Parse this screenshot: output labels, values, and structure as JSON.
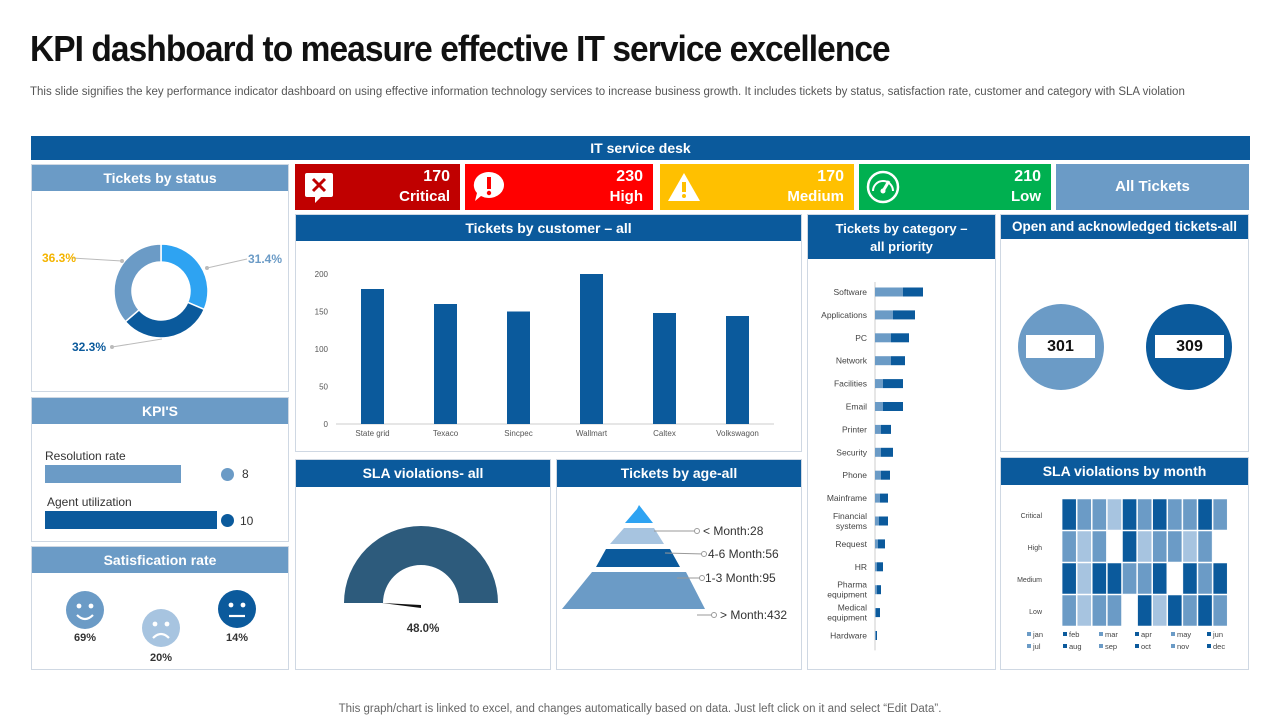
{
  "header": {
    "title": "KPI dashboard to measure effective IT service excellence",
    "subtitle": "This slide signifies the key performance indicator dashboard on using effective information technology services to increase business growth. It includes tickets by status, satisfaction rate, customer and category with SLA violation"
  },
  "banner": "IT service desk",
  "colors": {
    "dark_blue": "#0b5a9c",
    "mid_blue": "#6b9bc6",
    "light_blue": "#a7c4e0",
    "critical": "#c00000",
    "high": "#ff0000",
    "medium": "#ffc000",
    "low": "#00b050"
  },
  "status_cards": [
    {
      "value": "170",
      "label": "Critical",
      "icon": "x-alert-icon"
    },
    {
      "value": "230",
      "label": "High",
      "icon": "exclamation-bubble-icon"
    },
    {
      "value": "170",
      "label": "Medium",
      "icon": "warning-triangle-icon"
    },
    {
      "value": "210",
      "label": "Low",
      "icon": "speedometer-icon"
    }
  ],
  "all_tickets": "All Tickets",
  "tickets_by_status": {
    "title": "Tickets by status",
    "labels": [
      "36.3%",
      "31.4%",
      "32.3%"
    ],
    "chart_data": {
      "type": "pie",
      "values": [
        36.3,
        31.4,
        32.3
      ]
    }
  },
  "kpis": {
    "title": "KPI'S",
    "items": [
      {
        "label": "Resolution rate",
        "value": "8"
      },
      {
        "label": "Agent utilization",
        "value": "10"
      }
    ]
  },
  "satisfaction": {
    "title": "Satisfication rate",
    "items": [
      {
        "label": "69%",
        "icon": "happy-face-icon"
      },
      {
        "label": "20%",
        "icon": "sad-face-icon"
      },
      {
        "label": "14%",
        "icon": "neutral-face-icon"
      }
    ]
  },
  "tickets_by_customer": {
    "title": "Tickets by customer – all",
    "chart_data": {
      "type": "bar",
      "categories": [
        "State grid",
        "Texaco",
        "Sincpec",
        "Wallmart",
        "Caltex",
        "Volkswagon"
      ],
      "values": [
        180,
        160,
        150,
        200,
        148,
        144
      ],
      "ylim": [
        0,
        200
      ],
      "yticks": [
        "0",
        "50",
        "100",
        "150",
        "200"
      ]
    }
  },
  "tickets_by_category": {
    "title_line1": "Tickets by category –",
    "title_line2": "all priority",
    "chart_data": {
      "type": "bar",
      "categories": [
        "Software",
        "Applications",
        "PC",
        "Network",
        "Facilities",
        "Email",
        "Printer",
        "Security",
        "Phone",
        "Mainframe",
        "Financial systems",
        "Request",
        "HR",
        "Pharma equipment",
        "Medical equipment",
        "Hardware"
      ],
      "series": [
        {
          "values": [
            28,
            18,
            16,
            16,
            8,
            8,
            6,
            6,
            6,
            5,
            4,
            3,
            2,
            2,
            1,
            1
          ]
        },
        {
          "values": [
            20,
            22,
            18,
            14,
            20,
            20,
            10,
            12,
            9,
            8,
            9,
            7,
            6,
            4,
            4,
            1
          ]
        }
      ]
    }
  },
  "open_tickets": {
    "title": "Open and acknowledged tickets-all",
    "values": [
      "301",
      "309"
    ]
  },
  "sla_all": {
    "title": "SLA violations- all",
    "value_label": "48.0%",
    "chart_data": {
      "type": "pie",
      "values": [
        48.0
      ]
    }
  },
  "tickets_by_age": {
    "title": "Tickets by age-all",
    "chart_data": {
      "type": "bar",
      "categories": [
        "< Month",
        "4-6 Month",
        "1-3 Month",
        "> Month"
      ],
      "values": [
        28,
        56,
        95,
        432
      ]
    },
    "labels": [
      "< Month:28",
      "4-6 Month:56",
      "1-3 Month:95",
      "> Month:432"
    ]
  },
  "sla_by_month": {
    "title": "SLA violations by month",
    "chart_data": {
      "type": "heatmap",
      "rows": [
        "Critical",
        "High",
        "Medium",
        "Low"
      ],
      "columns": [
        "jan",
        "feb",
        "mar",
        "apr",
        "may",
        "jun",
        "jul",
        "aug",
        "sep",
        "oct",
        "nov",
        "dec"
      ],
      "levels": [
        [
          0,
          3,
          2,
          2,
          1,
          3,
          2,
          3,
          2,
          2,
          3,
          2
        ],
        [
          0,
          2,
          1,
          2,
          0,
          3,
          1,
          2,
          2,
          1,
          2,
          0
        ],
        [
          0,
          3,
          1,
          3,
          3,
          2,
          2,
          3,
          0,
          3,
          2,
          3
        ],
        [
          0,
          2,
          1,
          2,
          2,
          0,
          3,
          1,
          3,
          2,
          3,
          2
        ]
      ]
    }
  },
  "footnote": "This graph/chart is linked to excel, and changes automatically based on data. Just left click on it and select “Edit Data”."
}
